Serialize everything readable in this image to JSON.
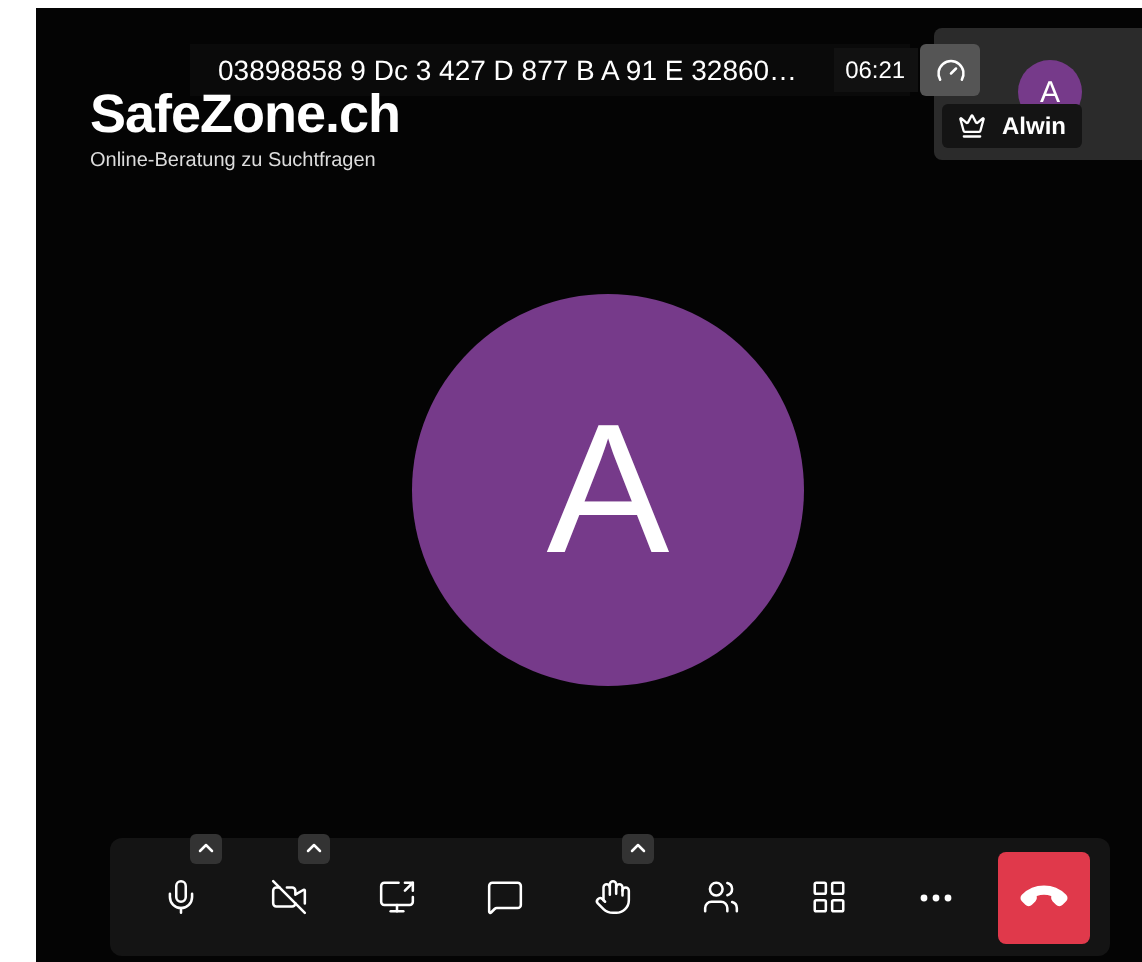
{
  "meeting": {
    "title": "03898858 9 Dc 3 427 D 877 B A 91 E 32860…",
    "timer": "06:21"
  },
  "logo": {
    "name": "SafeZone.ch",
    "tagline": "Online-Beratung zu Suchtfragen"
  },
  "main_participant": {
    "initial": "A",
    "color": "#763a8a"
  },
  "thumbnail": {
    "initial": "A",
    "name": "Alwin",
    "moderator": true,
    "color": "#763a8a"
  },
  "toolbar": [
    {
      "kind": "mic",
      "menu": true
    },
    {
      "kind": "camera-off",
      "menu": true
    },
    {
      "kind": "share",
      "menu": false
    },
    {
      "kind": "chat",
      "menu": false
    },
    {
      "kind": "hand",
      "menu": true
    },
    {
      "kind": "participants",
      "menu": false
    },
    {
      "kind": "tiles",
      "menu": false
    },
    {
      "kind": "more",
      "menu": false
    },
    {
      "kind": "hangup",
      "menu": false
    }
  ]
}
